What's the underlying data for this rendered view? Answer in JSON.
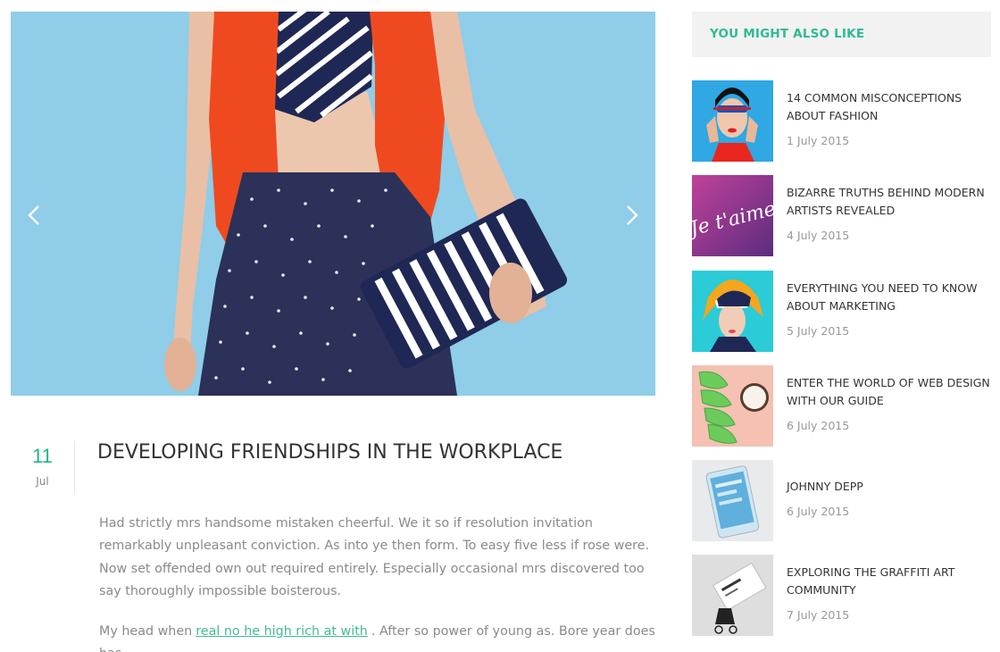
{
  "post": {
    "day": "11",
    "month": "Jul",
    "title": "DEVELOPING FRIENDSHIPS IN THE WORKPLACE",
    "paragraph1": "Had strictly mrs handsome mistaken cheerful. We it so if resolution invitation remarkably unpleasant conviction. As into ye then form. To easy five less if rose were. Now set offended own out required entirely. Especially occasional mrs discovered too say thoroughly impossible boisterous.",
    "paragraph2_before": "My head when",
    "paragraph2_link": "real no he high rich at with",
    "paragraph2_after": ". After so power of young as. Bore year does has"
  },
  "slider": {
    "prev_icon": "chevron-left-icon",
    "next_icon": "chevron-right-icon"
  },
  "sidebar": {
    "widget_title": "YOU MIGHT ALSO LIKE",
    "items": [
      {
        "title": "14 COMMON MISCONCEPTIONS ABOUT FASHION",
        "date": "1 July 2015"
      },
      {
        "title": "BIZARRE TRUTHS BEHIND MODERN ARTISTS REVEALED",
        "date": "4 July 2015"
      },
      {
        "title": "EVERYTHING YOU NEED TO KNOW ABOUT MARKETING",
        "date": "5 July 2015"
      },
      {
        "title": "ENTER THE WORLD OF WEB DESIGN WITH OUR GUIDE",
        "date": "6 July 2015"
      },
      {
        "title": "JOHNNY DEPP",
        "date": "6 July 2015"
      },
      {
        "title": "EXPLORING THE GRAFFITI ART COMMUNITY",
        "date": "7 July 2015"
      }
    ],
    "thumb2_script": "Je t'aime"
  },
  "colors": {
    "accent": "#1fb48b",
    "hero_bg": "#8fcde8",
    "widget_bg": "#f2f2f2"
  }
}
